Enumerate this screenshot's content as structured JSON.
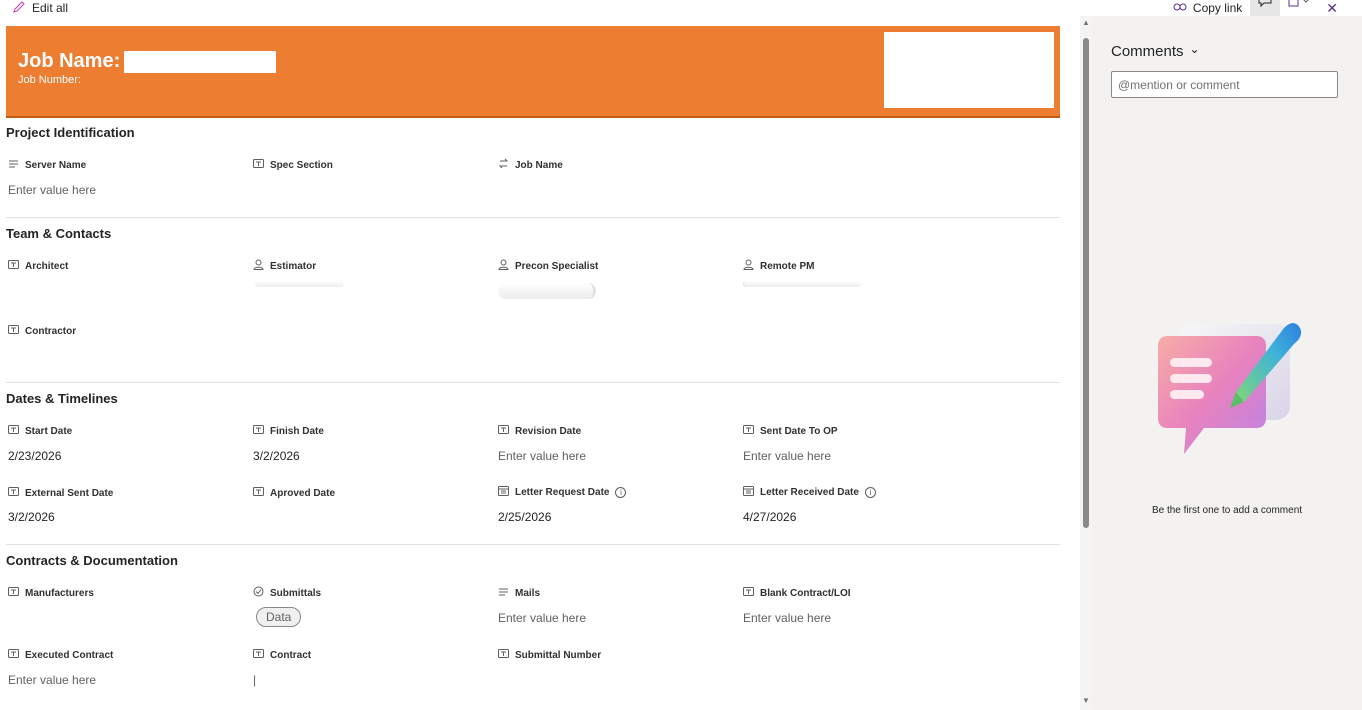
{
  "toolbar": {
    "edit_all": "Edit all",
    "copy_link": "Copy link",
    "close": "✕"
  },
  "header": {
    "job_name_label": "Job Name:",
    "job_number_label": "Job Number:",
    "background": "#ed7d31"
  },
  "sections": {
    "project": {
      "title": "Project Identification",
      "fields": [
        {
          "label": "Server Name",
          "value": "Enter value here"
        },
        {
          "label": "Spec Section",
          "value": ""
        },
        {
          "label": "Job Name",
          "value": ""
        }
      ]
    },
    "team": {
      "title": "Team & Contacts",
      "fields": [
        {
          "label": "Architect",
          "value": ""
        },
        {
          "label": "Estimator",
          "value": ""
        },
        {
          "label": "Precon Specialist",
          "value": ""
        },
        {
          "label": "Remote PM",
          "value": ""
        },
        {
          "label": "Contractor",
          "value": ""
        }
      ]
    },
    "dates": {
      "title": "Dates & Timelines",
      "fields": [
        {
          "label": "Start Date",
          "value": "2/23/2026"
        },
        {
          "label": "Finish Date",
          "value": "3/2/2026"
        },
        {
          "label": "Revision Date",
          "value": "Enter value here"
        },
        {
          "label": "Sent Date To OP",
          "value": "Enter value here"
        },
        {
          "label": "External Sent Date",
          "value": "3/2/2026"
        },
        {
          "label": "Aproved Date",
          "value": ""
        },
        {
          "label": "Letter Request Date",
          "value": "2/25/2026"
        },
        {
          "label": "Letter Received Date",
          "value": "4/27/2026"
        }
      ]
    },
    "contracts": {
      "title": "Contracts & Documentation",
      "fields": [
        {
          "label": "Manufacturers",
          "value": ""
        },
        {
          "label": "Submittals",
          "value": "Data"
        },
        {
          "label": "Mails",
          "value": "Enter value here"
        },
        {
          "label": "Blank Contract/LOI",
          "value": "Enter value here"
        },
        {
          "label": "Executed Contract",
          "value": "Enter value here"
        },
        {
          "label": "Contract",
          "value": "|"
        },
        {
          "label": "Submittal Number",
          "value": ""
        }
      ]
    }
  },
  "info_glyph": "i",
  "comments": {
    "title": "Comments",
    "chevron": "⌄",
    "placeholder": "@mention or comment",
    "empty_text": "Be the first one to add a comment"
  },
  "scroll": {
    "up": "▲",
    "down": "▼"
  }
}
